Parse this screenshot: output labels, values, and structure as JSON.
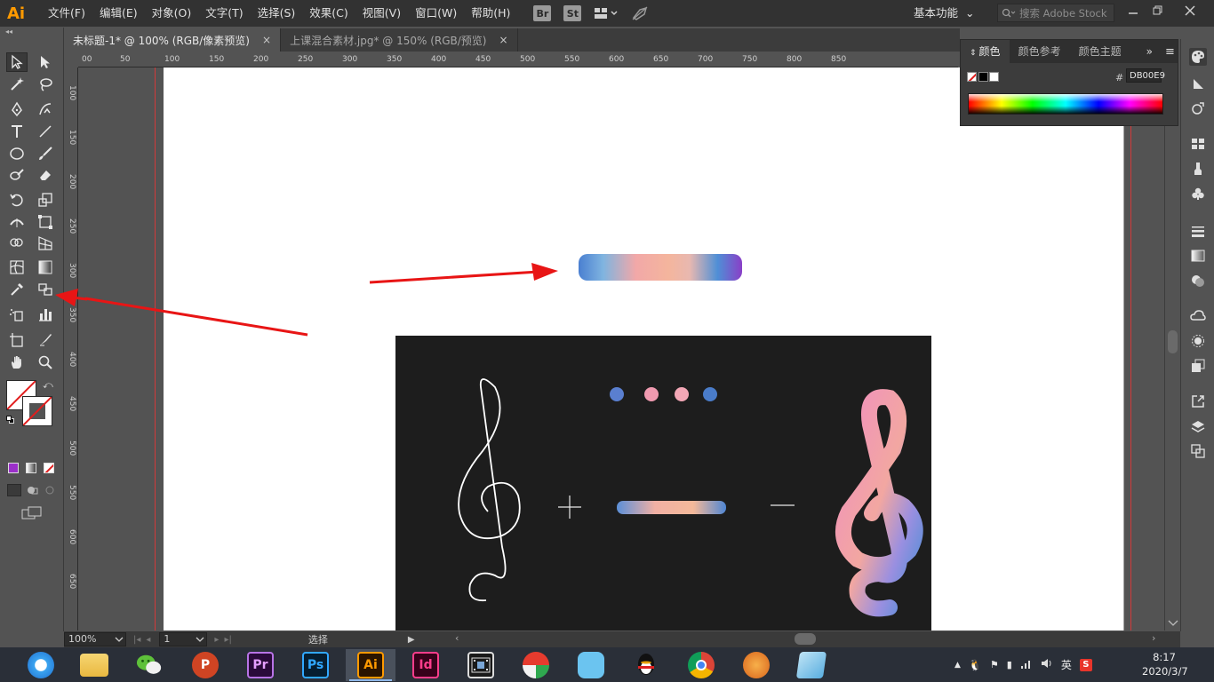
{
  "app": {
    "logo": "Ai"
  },
  "menu": [
    "文件(F)",
    "编辑(E)",
    "对象(O)",
    "文字(T)",
    "选择(S)",
    "效果(C)",
    "视图(V)",
    "窗口(W)",
    "帮助(H)"
  ],
  "menubar_buttons": {
    "bridge": "Br",
    "stock": "St"
  },
  "workspace": {
    "label": "基本功能",
    "chevron": "⌄"
  },
  "search": {
    "placeholder": "搜索 Adobe Stock"
  },
  "tabs": [
    {
      "label": "未标题-1* @ 100% (RGB/像素预览)",
      "close": "×"
    },
    {
      "label": "上课混合素材.jpg* @ 150% (RGB/预览)",
      "close": "×"
    }
  ],
  "ruler_h": [
    "00",
    "50",
    "100",
    "150",
    "200",
    "250",
    "300",
    "350",
    "400",
    "450",
    "500",
    "550",
    "600",
    "650",
    "700",
    "750",
    "800",
    "850"
  ],
  "ruler_v": [
    "100",
    "150",
    "200",
    "250",
    "300",
    "350",
    "400",
    "450",
    "500",
    "550",
    "600",
    "650"
  ],
  "color_panel": {
    "tabs": [
      "颜色",
      "颜色参考",
      "颜色主题"
    ],
    "hash": "#",
    "hex_value": "DB00E9",
    "more": "»",
    "menu": "≡"
  },
  "statusbar": {
    "zoom": "100%",
    "page": "1",
    "tool": "选择"
  },
  "taskbar": {
    "apps": [
      {
        "name": "qq-browser",
        "label": ""
      },
      {
        "name": "file-explorer",
        "label": ""
      },
      {
        "name": "wechat",
        "label": ""
      },
      {
        "name": "powerpoint",
        "label": "P"
      },
      {
        "name": "premiere",
        "label": "Pr"
      },
      {
        "name": "photoshop",
        "label": "Ps"
      },
      {
        "name": "illustrator",
        "label": "Ai"
      },
      {
        "name": "indesign",
        "label": "Id"
      },
      {
        "name": "video-editor",
        "label": ""
      },
      {
        "name": "app-colorful",
        "label": ""
      },
      {
        "name": "app-cat",
        "label": ""
      },
      {
        "name": "qq",
        "label": ""
      },
      {
        "name": "chrome",
        "label": ""
      },
      {
        "name": "app-orange",
        "label": ""
      },
      {
        "name": "app-blue",
        "label": ""
      }
    ],
    "tray_lang": "英",
    "clock_time": "8:17",
    "clock_date": "2020/3/7"
  },
  "colors": {
    "accent_ai": "#ff9a00",
    "gradient_bar": [
      "#4a7fd1",
      "#f2a8a8",
      "#8a3fc7"
    ],
    "annotation_arrow": "#e81515"
  }
}
